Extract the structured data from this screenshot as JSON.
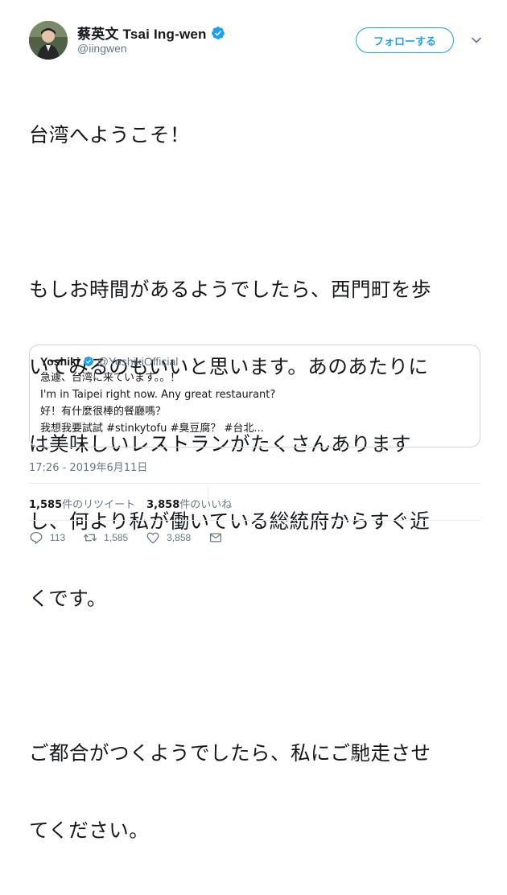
{
  "author": {
    "display_name": "蔡英文 Tsai Ing-wen",
    "handle": "@iingwen",
    "verified": true
  },
  "follow_button": {
    "label": "フォローする"
  },
  "tweet": {
    "lines": [
      "台湾へようこそ！",
      "",
      "もしお時間があるようでしたら、西門町を歩",
      "いてみるのもいいと思います。あのあたりに",
      "は美味しいレストランがたくさんあります",
      "し、何より私が働いている総統府からすぐ近",
      "くです。",
      "",
      "ご都合がつくようでしたら、私にご馳走させ",
      "てください。"
    ]
  },
  "quote": {
    "display_name": "Yoshiki",
    "handle": "@YoshikiOfficial",
    "verified": true,
    "lines": [
      "急遽、台湾に来ています。。！",
      "I'm in Taipei right now. Any great restaurant?",
      "好！有什麼很棒的餐廳嗎？",
      "我想我要試試 #stinkytofu #臭豆腐？ #台北..."
    ]
  },
  "timestamp": "17:26 - 2019年6月11日",
  "stats": {
    "retweets_count": "1,585",
    "retweets_label": "件のリツイート",
    "likes_count": "3,858",
    "likes_label": "件のいいね"
  },
  "actions": {
    "reply_count": "113",
    "retweet_count": "1,585",
    "like_count": "3,858"
  },
  "colors": {
    "accent": "#1da1f2",
    "text": "#14171a",
    "muted": "#657786",
    "border": "#ccd6dd"
  }
}
